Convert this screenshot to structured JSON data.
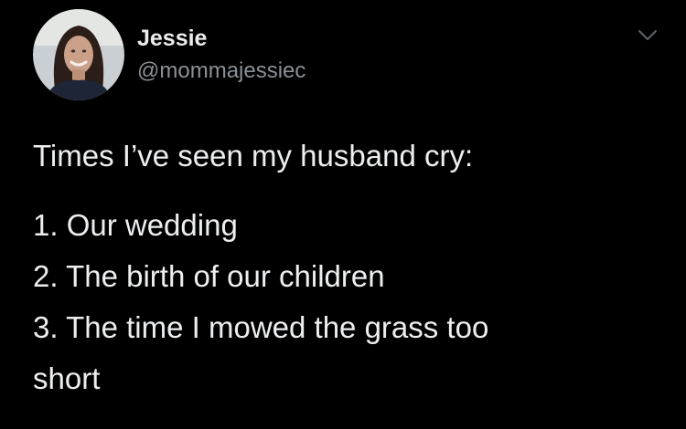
{
  "author": {
    "display_name": "Jessie",
    "handle": "@mommajessiec",
    "avatar_icon": "profile-photo"
  },
  "menu": {
    "icon": "chevron-down-icon"
  },
  "tweet": {
    "intro": "Times I’ve seen my husband cry:",
    "lines": [
      "1. Our wedding",
      "2. The birth of our children",
      "3. The time I mowed the grass too",
      "short"
    ]
  },
  "colors": {
    "background": "#000000",
    "text": "#eceef0",
    "secondary_text": "#8b9096"
  }
}
